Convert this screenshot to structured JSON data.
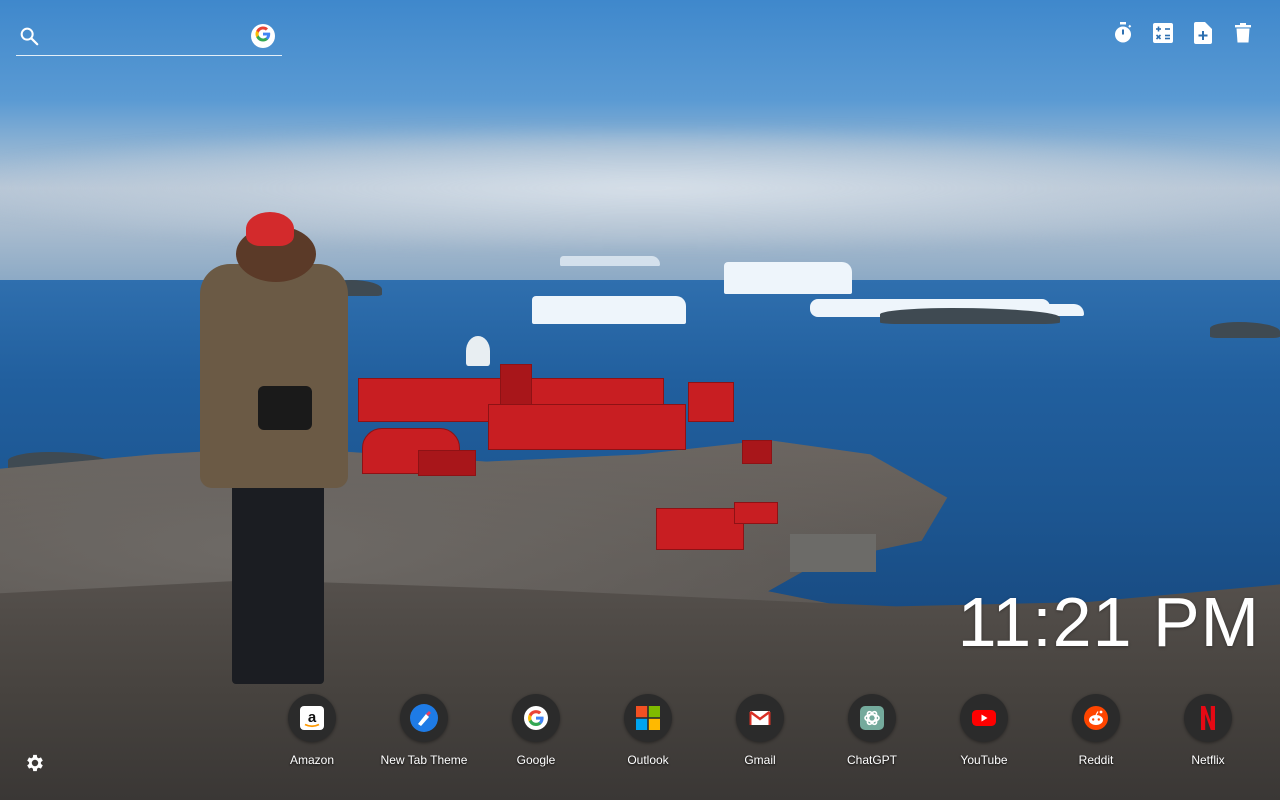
{
  "search": {
    "placeholder": "",
    "engine_icon": "google-icon"
  },
  "tools": [
    {
      "name": "timer",
      "icon": "timer-icon"
    },
    {
      "name": "calculator",
      "icon": "calculator-icon"
    },
    {
      "name": "add-note",
      "icon": "add-note-icon"
    },
    {
      "name": "trash",
      "icon": "trash-icon"
    }
  ],
  "clock": {
    "time": "11:21 PM"
  },
  "shortcuts": [
    {
      "label": "Amazon",
      "icon": "amazon-icon"
    },
    {
      "label": "New Tab Theme",
      "icon": "new-tab-theme-icon"
    },
    {
      "label": "Google",
      "icon": "google-icon"
    },
    {
      "label": "Outlook",
      "icon": "outlook-icon"
    },
    {
      "label": "Gmail",
      "icon": "gmail-icon"
    },
    {
      "label": "ChatGPT",
      "icon": "chatgpt-icon"
    },
    {
      "label": "YouTube",
      "icon": "youtube-icon"
    },
    {
      "label": "Reddit",
      "icon": "reddit-icon"
    },
    {
      "label": "Netflix",
      "icon": "netflix-icon"
    }
  ],
  "settings": {
    "icon": "gear-icon"
  },
  "colors": {
    "text": "#ffffff",
    "shortcut_bg": "#2b2b2b",
    "sky": "#3f88cc",
    "sea": "#215f9e",
    "station_red": "#c81e22"
  }
}
